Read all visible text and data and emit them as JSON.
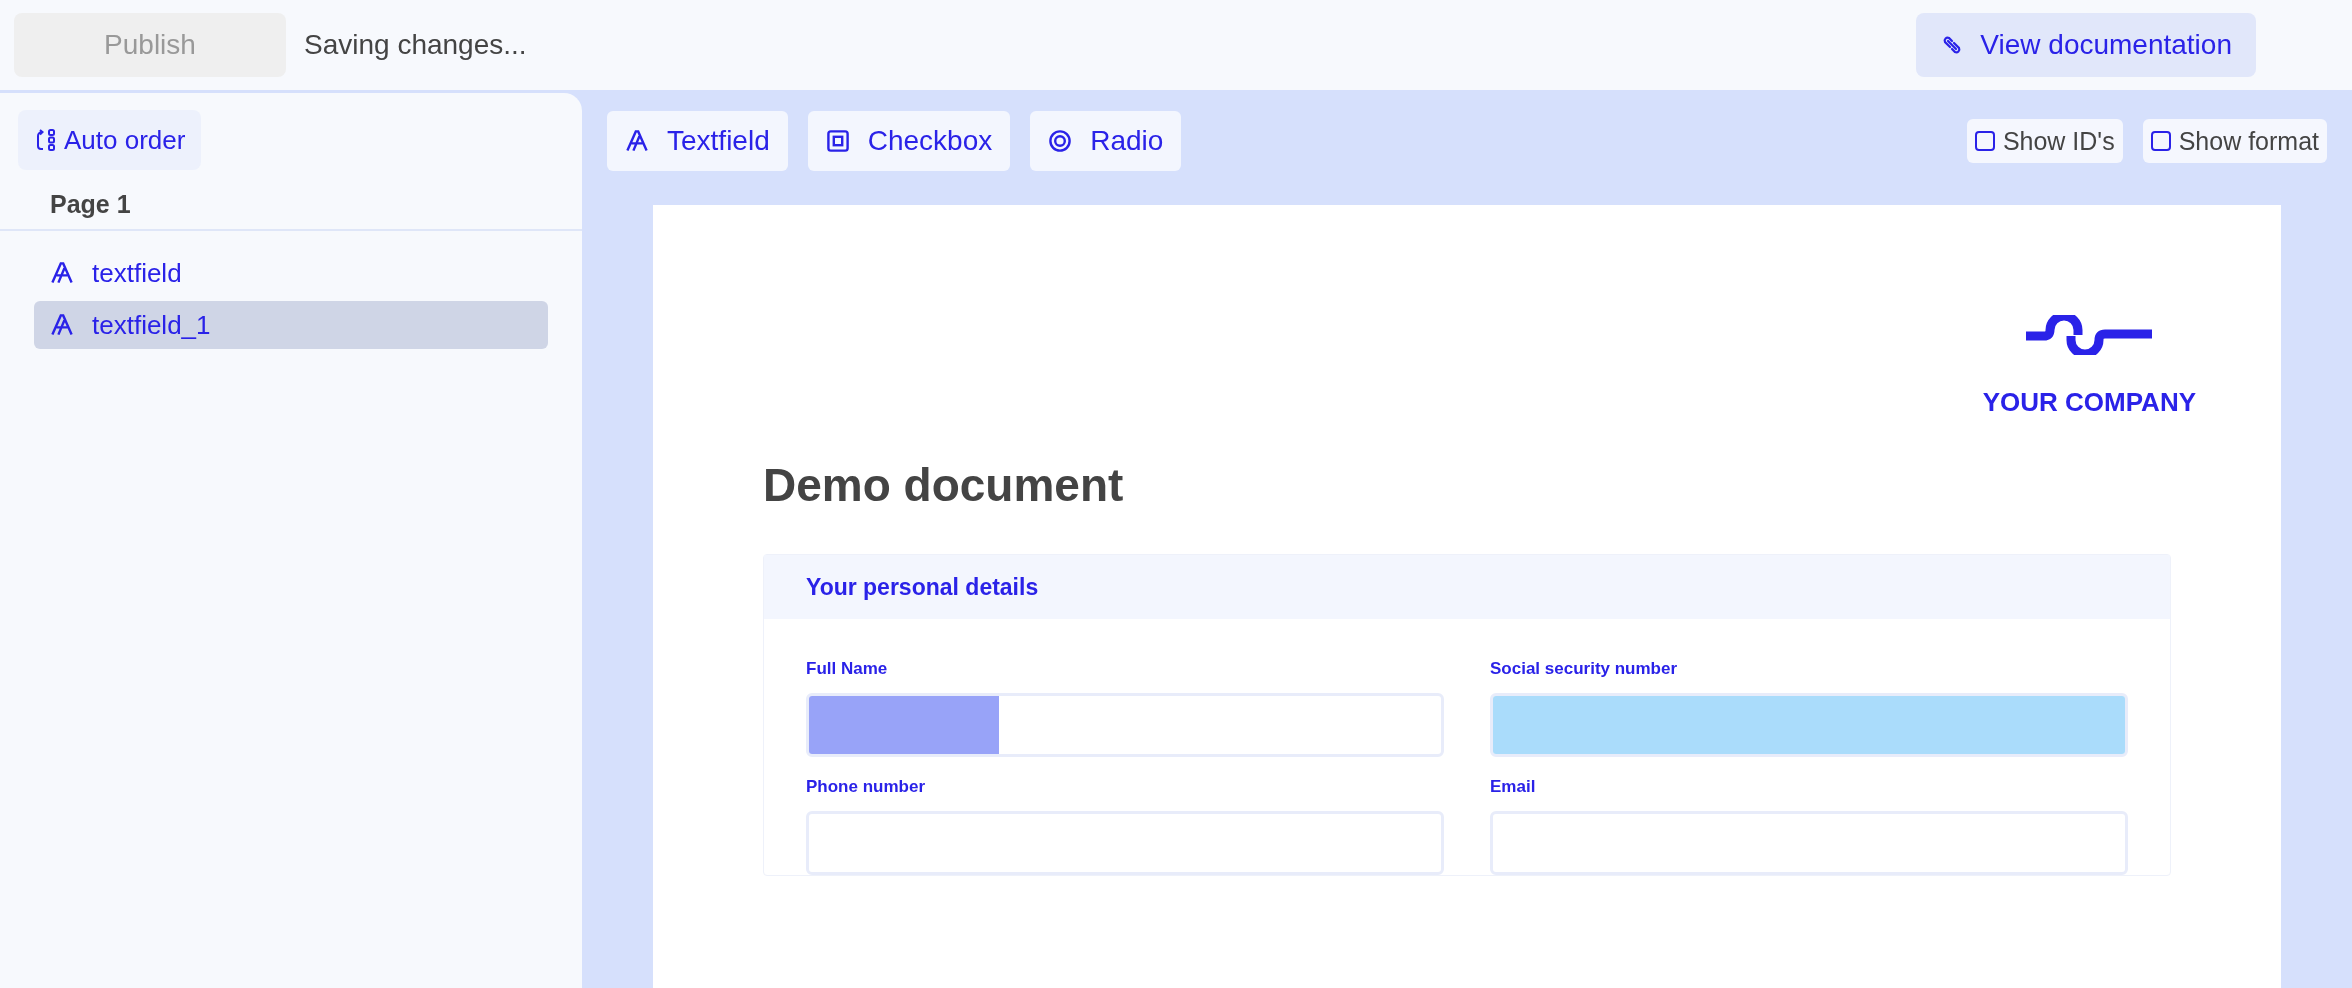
{
  "top_bar": {
    "publish_button": {
      "label": "Publish",
      "disabled": true
    },
    "status": "Saving changes...",
    "docs_button": "View documentation"
  },
  "sidebar": {
    "auto_order_button": "Auto order",
    "page_title": "Page 1",
    "items": [
      {
        "label": "textfield",
        "selected": false
      },
      {
        "label": "textfield_1",
        "selected": true
      }
    ]
  },
  "toolbar": {
    "tools": [
      {
        "kind": "textfield",
        "label": "Textfield"
      },
      {
        "kind": "checkbox",
        "label": "Checkbox"
      },
      {
        "kind": "radio",
        "label": "Radio"
      }
    ],
    "toggles": [
      {
        "label": "Show ID's",
        "checked": false
      },
      {
        "label": "Show format",
        "checked": false
      }
    ]
  },
  "document": {
    "company": "YOUR COMPANY",
    "title": "Demo document",
    "section": {
      "title": "Your personal details",
      "fields": [
        {
          "label": "Full Name",
          "color": "#98a3f8",
          "level": 0.3
        },
        {
          "label": "Social security number",
          "color": "#aadcfb",
          "level": 1
        },
        {
          "label": "Phone number"
        },
        {
          "label": "Email"
        }
      ]
    }
  }
}
